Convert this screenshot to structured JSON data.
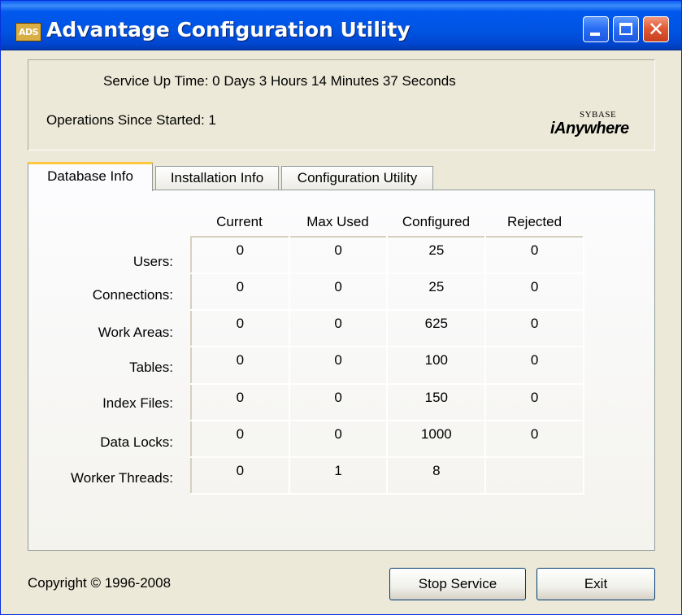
{
  "window": {
    "title": "Advantage Configuration Utility",
    "icon_text": "ADS",
    "controls": [
      "minimize-icon",
      "maximize-icon",
      "close-icon"
    ],
    "close_glyph": "✕"
  },
  "status": {
    "uptime": "Service Up Time:  0 Days 3 Hours 14 Minutes 37 Seconds",
    "operations": "Operations Since Started:  1"
  },
  "logo": {
    "top": "SYBASE",
    "bottom": "iAnywhere"
  },
  "tabs": [
    {
      "label": "Database Info",
      "active": true
    },
    {
      "label": "Installation Info",
      "active": false
    },
    {
      "label": "Configuration Utility",
      "active": false
    }
  ],
  "table": {
    "columns": [
      "Current",
      "Max Used",
      "Configured",
      "Rejected"
    ],
    "rows": [
      {
        "label": "Users:",
        "values": [
          "0",
          "0",
          "25",
          "0"
        ]
      },
      {
        "label": "Connections:",
        "values": [
          "0",
          "0",
          "25",
          "0"
        ]
      },
      {
        "label": "Work Areas:",
        "values": [
          "0",
          "0",
          "625",
          "0"
        ]
      },
      {
        "label": "Tables:",
        "values": [
          "0",
          "0",
          "100",
          "0"
        ]
      },
      {
        "label": "Index Files:",
        "values": [
          "0",
          "0",
          "150",
          "0"
        ]
      },
      {
        "label": "Data Locks:",
        "values": [
          "0",
          "0",
          "1000",
          "0"
        ]
      },
      {
        "label": "Worker Threads:",
        "values": [
          "0",
          "1",
          "8",
          ""
        ]
      }
    ]
  },
  "footer": {
    "copyright": "Copyright © 1996-2008",
    "stop_label": "Stop Service",
    "exit_label": "Exit"
  },
  "colors": {
    "titlebar": "#0054e3",
    "active_tab_accent": "#ffc83c",
    "window_bg": "#ece9d8"
  }
}
